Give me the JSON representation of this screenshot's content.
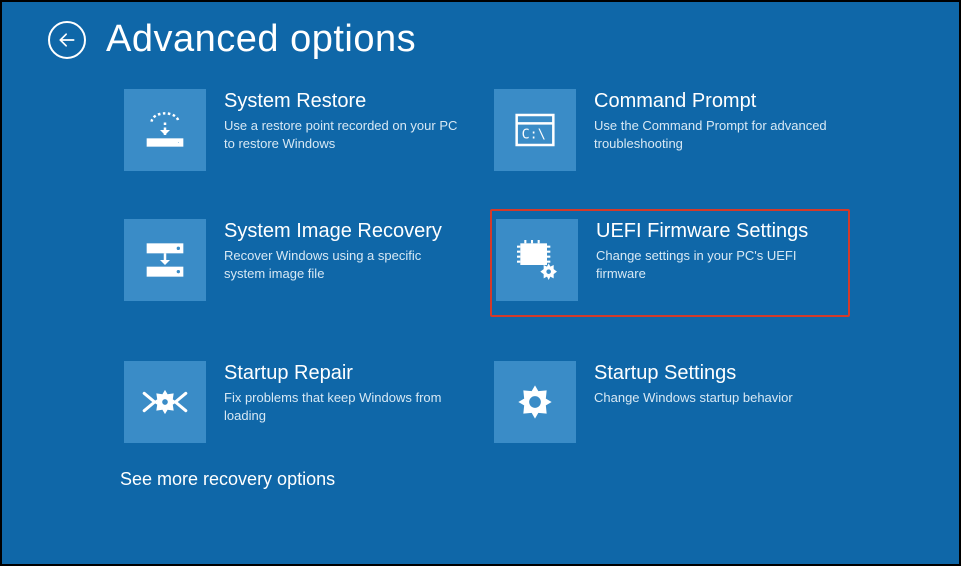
{
  "header": {
    "title": "Advanced options"
  },
  "tiles": [
    {
      "title": "System Restore",
      "desc": "Use a restore point recorded on your PC to restore Windows"
    },
    {
      "title": "Command Prompt",
      "desc": "Use the Command Prompt for advanced troubleshooting"
    },
    {
      "title": "System Image Recovery",
      "desc": "Recover Windows using a specific system image file"
    },
    {
      "title": "UEFI Firmware Settings",
      "desc": "Change settings in your PC's UEFI firmware"
    },
    {
      "title": "Startup Repair",
      "desc": "Fix problems that keep Windows from loading"
    },
    {
      "title": "Startup Settings",
      "desc": "Change Windows startup behavior"
    }
  ],
  "more_link": "See more recovery options"
}
